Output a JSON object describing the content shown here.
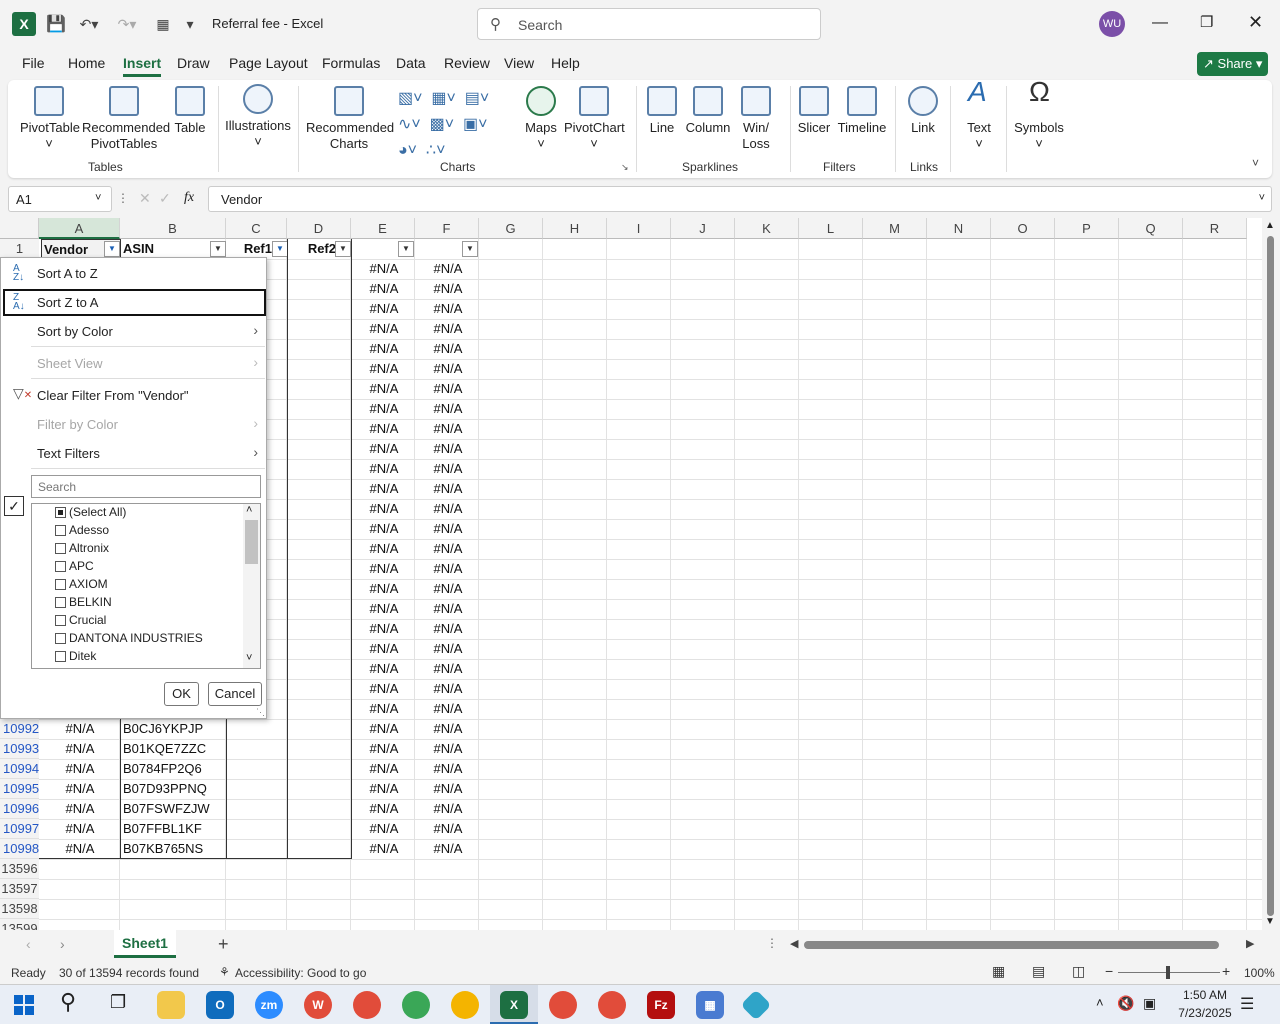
{
  "window": {
    "title": "Referral fee  -  Excel",
    "search_placeholder": "Search",
    "user_initials": "WU"
  },
  "tabs": [
    "File",
    "Home",
    "Insert",
    "Draw",
    "Page Layout",
    "Formulas",
    "Data",
    "Review",
    "View",
    "Help"
  ],
  "share_label": "Share",
  "ribbon": {
    "pivot_table": "PivotTable",
    "rec_pivot_1": "Recommended",
    "rec_pivot_2": "PivotTables",
    "table": "Table",
    "illustrations": "Illustrations",
    "rec_charts_1": "Recommended",
    "rec_charts_2": "Charts",
    "maps": "Maps",
    "pivot_chart": "PivotChart",
    "line": "Line",
    "column": "Column",
    "winloss_1": "Win/",
    "winloss_2": "Loss",
    "slicer": "Slicer",
    "timeline": "Timeline",
    "link": "Link",
    "text": "Text",
    "symbols": "Symbols",
    "groups": {
      "tables": "Tables",
      "charts": "Charts",
      "sparklines": "Sparklines",
      "filters": "Filters",
      "links": "Links"
    }
  },
  "formula_bar": {
    "name_box": "A1",
    "fx": "fx",
    "value": "Vendor"
  },
  "columns": [
    "A",
    "B",
    "C",
    "D",
    "E",
    "F",
    "G",
    "H",
    "I",
    "J",
    "K",
    "L",
    "M",
    "N",
    "O",
    "P",
    "Q",
    "R"
  ],
  "header_row": {
    "row": "1",
    "a": "Vendor",
    "b": "ASIN",
    "c": "Ref1",
    "d": "Ref2"
  },
  "na": "#N/A",
  "data_rows": [
    {
      "row": "10992",
      "a": "#N/A",
      "b": "B0CJ6YKPJP"
    },
    {
      "row": "10993",
      "a": "#N/A",
      "b": "B01KQE7ZZC"
    },
    {
      "row": "10994",
      "a": "#N/A",
      "b": "B0784FP2Q6"
    },
    {
      "row": "10995",
      "a": "#N/A",
      "b": "B07D93PPNQ"
    },
    {
      "row": "10996",
      "a": "#N/A",
      "b": "B07FSWFZJW"
    },
    {
      "row": "10997",
      "a": "#N/A",
      "b": "B07FFBL1KF"
    },
    {
      "row": "10998",
      "a": "#N/A",
      "b": "B07KB765NS"
    }
  ],
  "empty_rows": [
    "13596",
    "13597",
    "13598",
    "13599"
  ],
  "filter_menu": {
    "sort_az": "Sort A to Z",
    "sort_za": "Sort Z to A",
    "sort_color": "Sort by Color",
    "sheet_view": "Sheet View",
    "clear_filter": "Clear Filter From \"Vendor\"",
    "filter_color": "Filter by Color",
    "text_filters": "Text Filters",
    "search_placeholder": "Search",
    "items": [
      "(Select All)",
      "Adesso",
      "Altronix",
      "APC",
      "AXIOM",
      "BELKIN",
      "Crucial",
      "DANTONA INDUSTRIES",
      "Ditek"
    ],
    "ok": "OK",
    "cancel": "Cancel"
  },
  "sheet_tab": "Sheet1",
  "status": {
    "ready": "Ready",
    "records": "30 of 13594 records found",
    "accessibility": "Accessibility: Good to go",
    "zoom": "100%"
  },
  "clock": {
    "time": "1:50 AM",
    "date": "7/23/2025"
  }
}
